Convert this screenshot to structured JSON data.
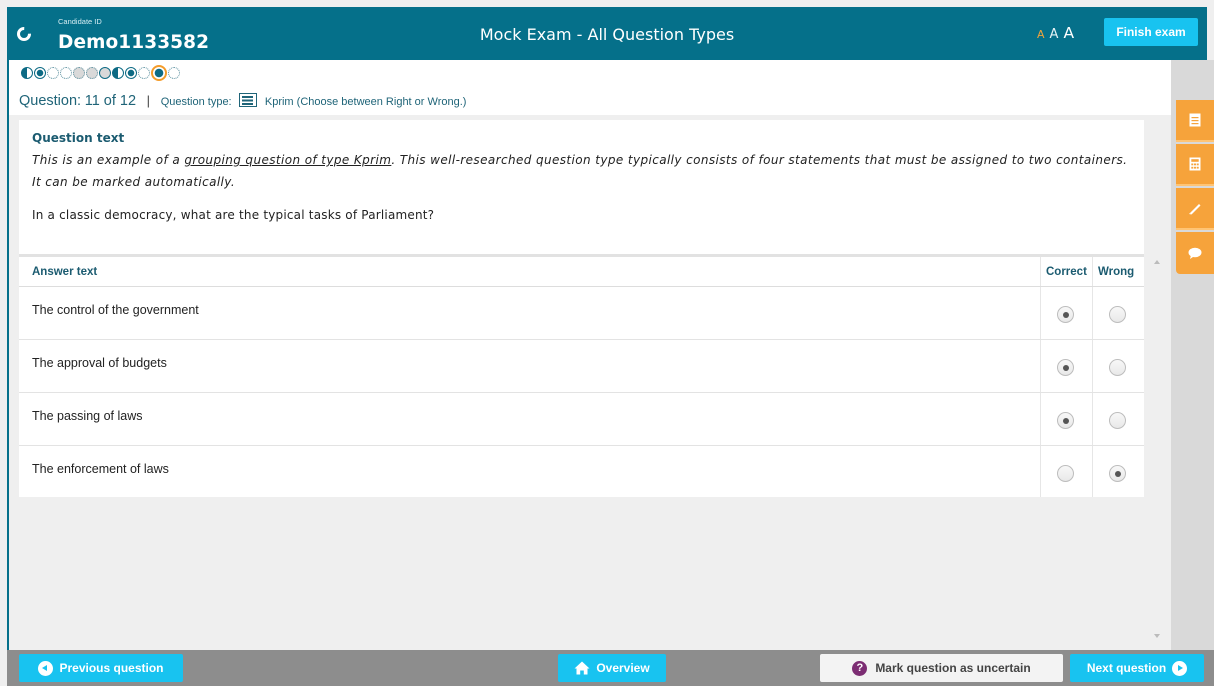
{
  "header": {
    "candidate_label": "Candidate ID",
    "candidate_id": "Demo1133582",
    "exam_title": "Mock Exam - All Question Types",
    "font_small": "A",
    "font_medium": "A",
    "font_large": "A",
    "finish_label": "Finish exam"
  },
  "nav": {
    "question_prefix": "Question:",
    "question_current": "11 of 12",
    "separator": "|",
    "type_prefix": "Question type:",
    "type_label": "Kprim (Choose between Right or Wrong.)"
  },
  "question": {
    "title": "Question text",
    "body_part1": "This is an example of a ",
    "body_link": "grouping question of type Kprim",
    "body_part2": ". This well-researched question type typically consists of four statements that must be assigned to two containers. It can be marked automatically.",
    "prompt": "In a classic democracy, what are the typical tasks of Parliament?"
  },
  "answers": {
    "header_answer": "Answer text",
    "header_correct": "Correct",
    "header_wrong": "Wrong",
    "rows": [
      {
        "text": "The control of the government",
        "selected": "correct"
      },
      {
        "text": "The approval of budgets",
        "selected": "correct"
      },
      {
        "text": "The passing of laws",
        "selected": "correct"
      },
      {
        "text": "The enforcement of laws",
        "selected": "wrong"
      }
    ]
  },
  "tools": [
    "notes-icon",
    "calculator-icon",
    "pen-icon",
    "comment-icon"
  ],
  "footer": {
    "prev_label": "Previous question",
    "overview_label": "Overview",
    "uncertain_icon": "?",
    "uncertain_label": "Mark question as uncertain",
    "next_label": "Next question"
  },
  "colors": {
    "header_bg": "#05708a",
    "accent": "#18c3f0",
    "tool_orange": "#f6a33b",
    "current_ring": "#f49c2b"
  }
}
